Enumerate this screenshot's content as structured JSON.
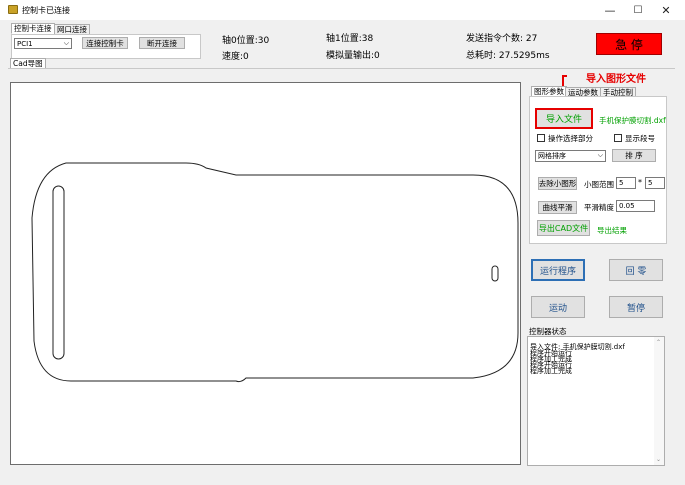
{
  "window": {
    "title": "控制卡已连接",
    "buttons": {
      "minimize": "—",
      "maximize": "☐",
      "close": "✕"
    }
  },
  "connection": {
    "tabs": [
      "控制卡连接",
      "网口连接"
    ],
    "port_value": "PCI1",
    "connect_label": "连接控制卡",
    "disconnect_label": "断开连接"
  },
  "status": {
    "axis0": "轴0位置:30",
    "axis1": "轴1位置:38",
    "speed": "速度:0",
    "analog": "模拟量输出:0",
    "sent_count": "发送指令个数: 27",
    "elapsed": "总耗时: 27.5295ms",
    "estop_label": "急  停"
  },
  "canvas_tab": "Cad导图",
  "annotation": "导入图形文件",
  "graphic_tabs": [
    "图形参数",
    "运动参数",
    "手动控制"
  ],
  "graphic": {
    "import_label": "导入文件",
    "file_name": "手机保护膜切割.dxf",
    "op_selected_label": "操作选择部分",
    "show_segment_label": "显示段号",
    "sort_mode": "网格排序",
    "sort_label": "排  序",
    "remove_small_label": "去除小图形",
    "small_range_label": "小图范围",
    "small_w": "5",
    "times": "*",
    "small_h": "5",
    "smooth_label": "曲线平滑",
    "smooth_precision_label": "平滑精度",
    "smooth_precision_value": "0.05",
    "export_label": "导出CAD文件",
    "export_result_label": "导出结果"
  },
  "actions": {
    "run_label": "运行程序",
    "home_label": "回  零",
    "move_label": "运动",
    "pause_label": "暂停"
  },
  "log": {
    "title": "控制器状态",
    "lines": [
      "导入文件: 手机保护膜切割.dxf",
      "程序开始运行",
      "程序加工完成",
      "程序开始运行",
      "程序加工完成"
    ]
  },
  "colors": {
    "estop_bg": "#ff0000",
    "estop_text": "#000000",
    "annotation_red": "#e60000",
    "green_text": "#00a000",
    "blue_text": "#1e4f8a"
  }
}
